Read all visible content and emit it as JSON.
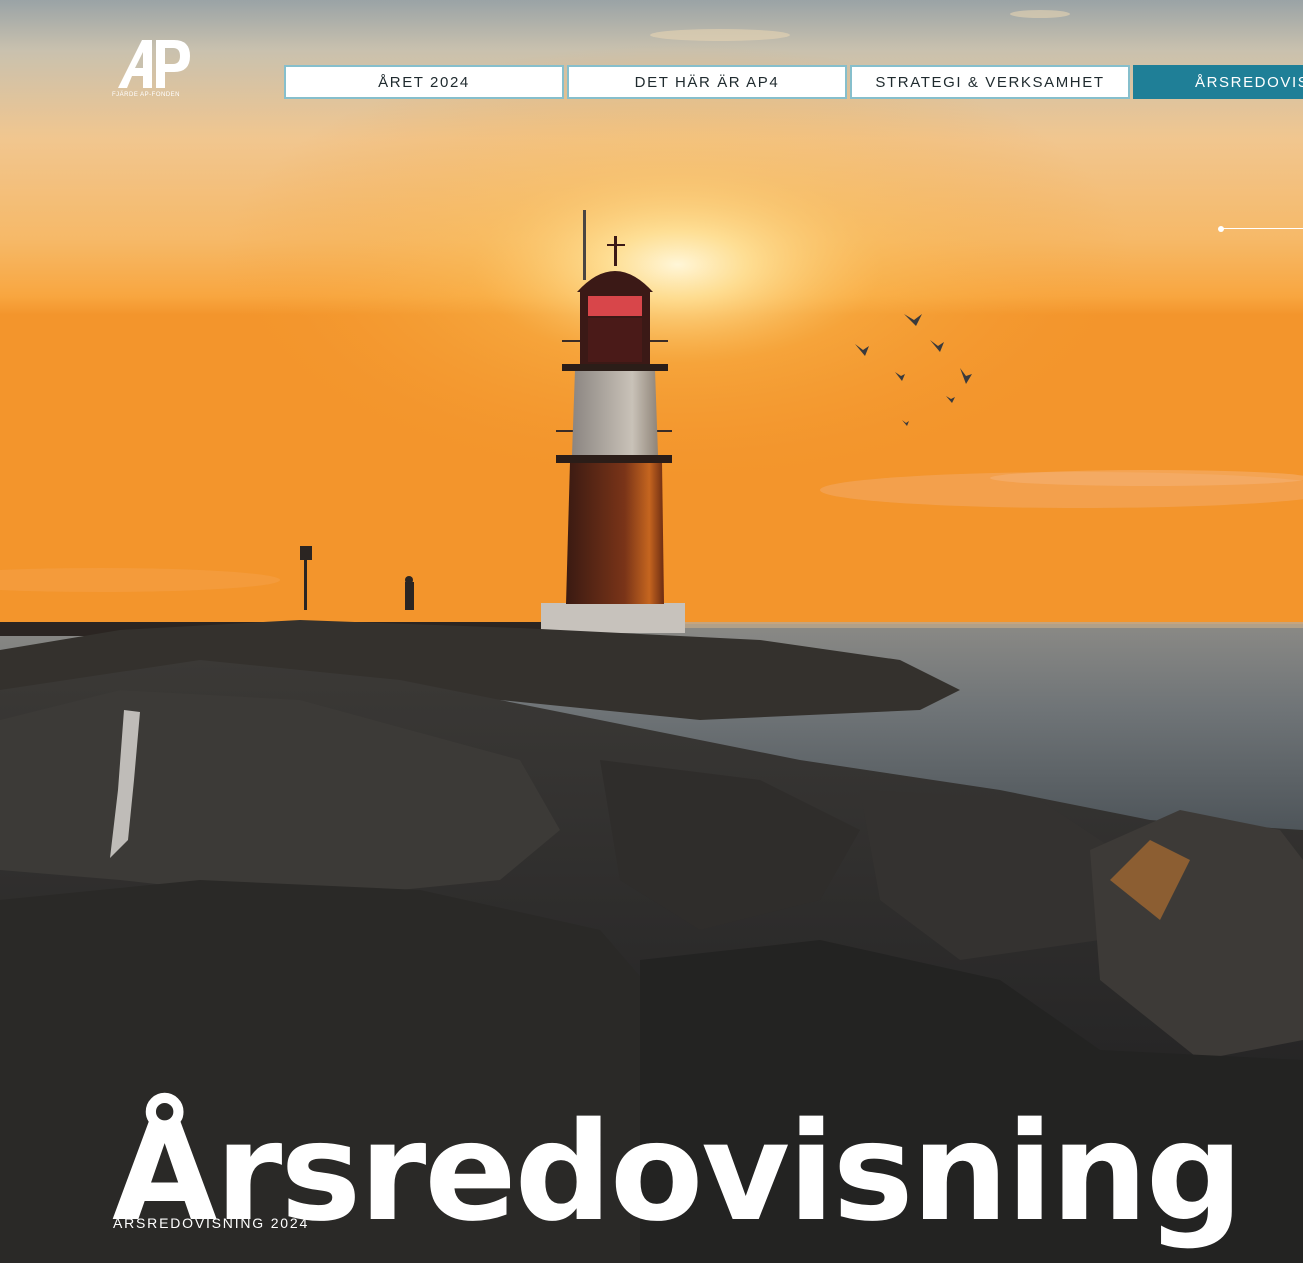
{
  "logo": {
    "mark": "AP",
    "subtitle": "FJÄRDE AP-FONDEN"
  },
  "nav": {
    "items": [
      {
        "label": "ÅRET 2024"
      },
      {
        "label": "DET HÄR ÄR AP4"
      },
      {
        "label": "STRATEGI & VERKSAMHET"
      },
      {
        "label": "ÅRSREDOVISNING"
      }
    ],
    "active_color": "#1f7f97",
    "border_color": "#86bfcc"
  },
  "hero": {
    "title": "Årsredovisning",
    "subtitle": "ÅRSREDOVISNING 2024",
    "image": "lighthouse-at-sunset-on-rocky-pier"
  }
}
